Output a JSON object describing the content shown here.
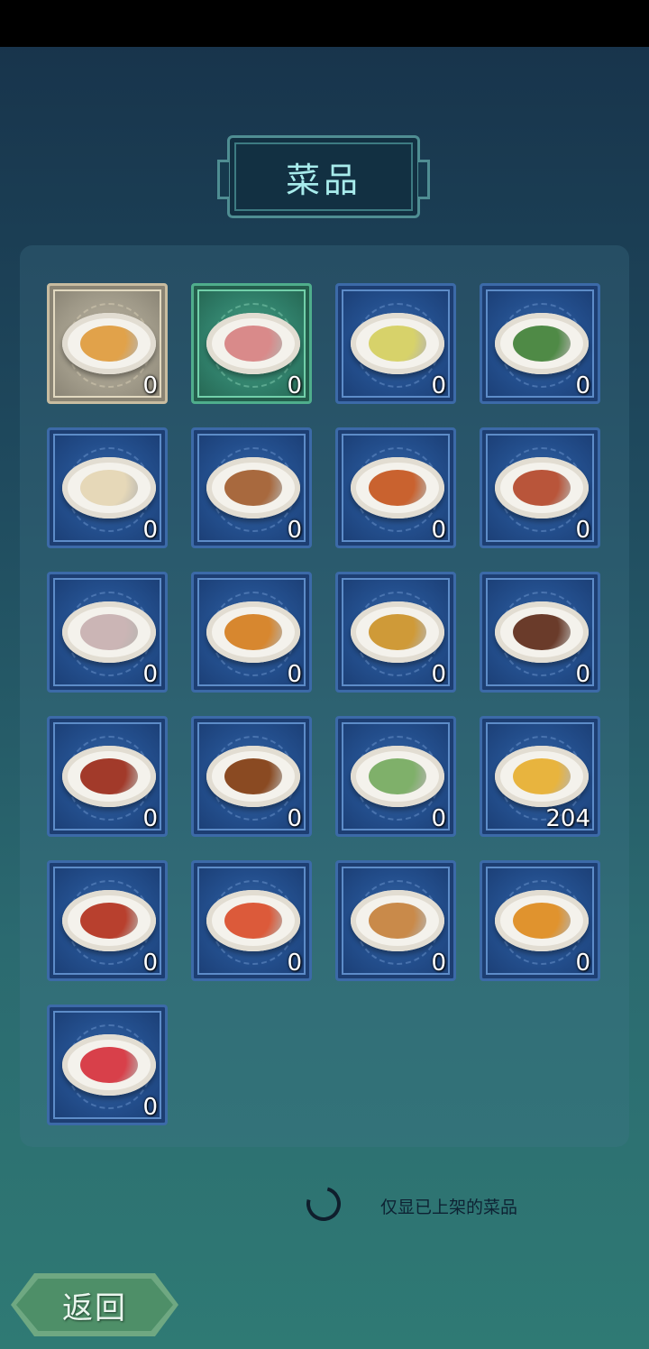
{
  "title": "菜品",
  "dishes": [
    {
      "icon": "scrambled-egg-dish-icon",
      "count": "0",
      "frame": "gold",
      "color": "#e1a24a"
    },
    {
      "icon": "soup-bowl-icon",
      "count": "0",
      "frame": "green",
      "color": "#d98a8a"
    },
    {
      "icon": "cucumber-egg-dish-icon",
      "count": "0",
      "frame": "blue",
      "color": "#d7d26a"
    },
    {
      "icon": "green-vegetable-soup-icon",
      "count": "0",
      "frame": "blue",
      "color": "#4f8a46"
    },
    {
      "icon": "cabbage-dish-icon",
      "count": "0",
      "frame": "blue",
      "color": "#e6d8b8"
    },
    {
      "icon": "teapot-icon",
      "count": "0",
      "frame": "blue",
      "color": "#a8693e"
    },
    {
      "icon": "kung-pao-dish-icon",
      "count": "0",
      "frame": "blue",
      "color": "#c9622f"
    },
    {
      "icon": "stir-fry-dish-icon",
      "count": "0",
      "frame": "blue",
      "color": "#b9553a"
    },
    {
      "icon": "tofu-platter-icon",
      "count": "0",
      "frame": "blue",
      "color": "#cbb5b5"
    },
    {
      "icon": "skewers-icon",
      "count": "0",
      "frame": "blue",
      "color": "#d7872f"
    },
    {
      "icon": "peanut-chicken-dish-icon",
      "count": "0",
      "frame": "blue",
      "color": "#cf9a38"
    },
    {
      "icon": "rice-cake-leaf-icon",
      "count": "0",
      "frame": "blue",
      "color": "#6a3b2a"
    },
    {
      "icon": "braised-pork-dish-icon",
      "count": "0",
      "frame": "blue",
      "color": "#a23a2a"
    },
    {
      "icon": "meatball-dish-icon",
      "count": "0",
      "frame": "blue",
      "color": "#8a4a22"
    },
    {
      "icon": "bok-choy-dish-icon",
      "count": "0",
      "frame": "blue",
      "color": "#7fb06a"
    },
    {
      "icon": "stuffed-tofu-dish-icon",
      "count": "204",
      "frame": "blue",
      "color": "#e8b43e"
    },
    {
      "icon": "hot-pot-icon",
      "count": "0",
      "frame": "blue",
      "color": "#b8402e"
    },
    {
      "icon": "shrimp-dish-icon",
      "count": "0",
      "frame": "blue",
      "color": "#dc5a3a"
    },
    {
      "icon": "pepper-pork-dish-icon",
      "count": "0",
      "frame": "blue",
      "color": "#c98a4a"
    },
    {
      "icon": "fried-cake-dish-icon",
      "count": "0",
      "frame": "blue",
      "color": "#e0932e"
    },
    {
      "icon": "watermelon-fruit-bowl-icon",
      "count": "0",
      "frame": "blue",
      "color": "#d8404a"
    }
  ],
  "filter_hint": "仅显已上架的菜品",
  "back_label": "返回"
}
